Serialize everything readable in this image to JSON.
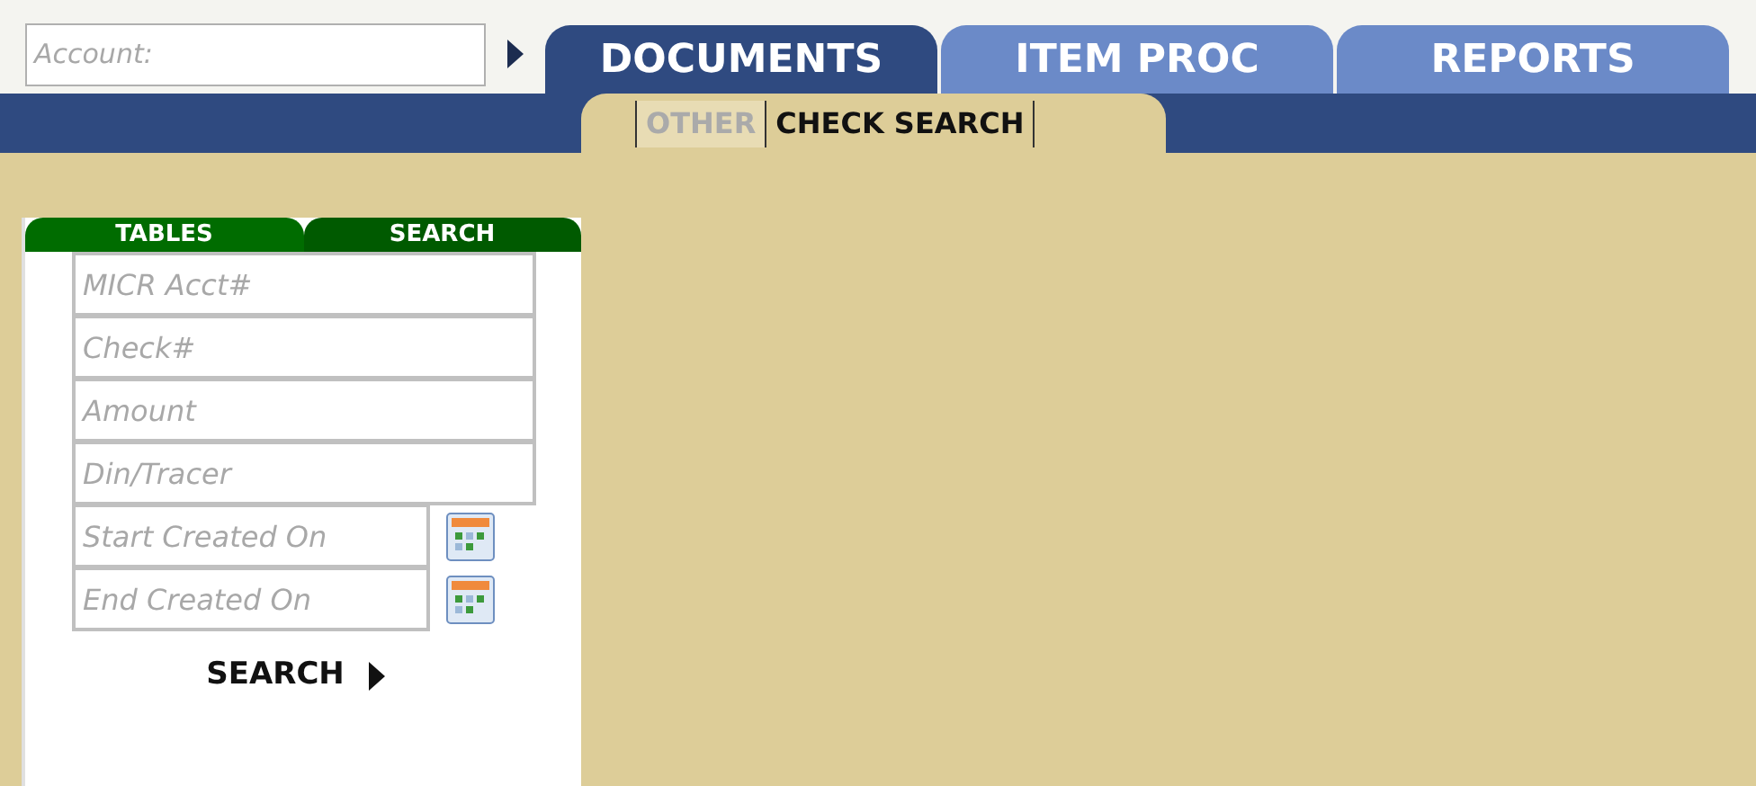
{
  "account": {
    "placeholder": "Account:"
  },
  "tabs": [
    {
      "label": "DOCUMENTS",
      "selected": true
    },
    {
      "label": "ITEM PROC",
      "selected": false
    },
    {
      "label": "REPORTS",
      "selected": false
    }
  ],
  "subtabs": [
    {
      "label": "OTHER",
      "selected": false
    },
    {
      "label": "CHECK SEARCH",
      "selected": true
    }
  ],
  "panel_tabs": [
    {
      "label": "TABLES",
      "selected": false
    },
    {
      "label": "SEARCH",
      "selected": true
    }
  ],
  "fields": [
    {
      "kind": "text",
      "placeholder": "MICR Acct#"
    },
    {
      "kind": "text",
      "placeholder": "Check#"
    },
    {
      "kind": "text",
      "placeholder": "Amount"
    },
    {
      "kind": "text",
      "placeholder": "Din/Tracer"
    },
    {
      "kind": "date",
      "placeholder": "Start Created On"
    },
    {
      "kind": "date",
      "placeholder": "End Created On"
    }
  ],
  "search_button": {
    "label": "SEARCH"
  }
}
